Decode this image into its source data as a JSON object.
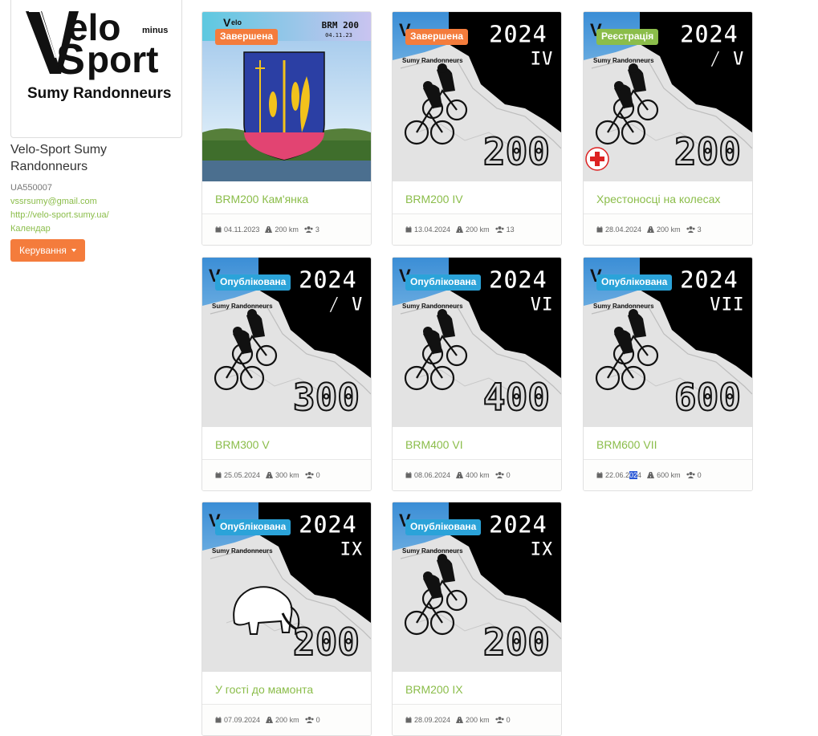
{
  "sidebar": {
    "logo": {
      "line1": "elo",
      "line2": "port",
      "minus": "minus",
      "subtitle": "Sumy Randonneurs"
    },
    "club_name": "Velo-Sport Sumy Randonneurs",
    "club_code": "UA550007",
    "email": "vssrsumy@gmail.com",
    "website": "http://velo-sport.sumy.ua/",
    "calendar": "Календар",
    "manage_button": "Керування"
  },
  "colors": {
    "accent_green": "#8bbd4a",
    "accent_orange": "#f47c3c",
    "accent_blue": "#2ba3d9"
  },
  "cards": [
    {
      "badge": "Завершена",
      "badge_color": "orange",
      "title": "BRM200 Кам'янка",
      "date": "04.11.2023",
      "distance": "200 km",
      "participants": "3",
      "poster": {
        "style": "river",
        "top_label": "BRM 200",
        "top_date": "04.11.23",
        "brand": "elo"
      }
    },
    {
      "badge": "Завершена",
      "badge_color": "orange",
      "title": "BRM200 IV",
      "date": "13.04.2024",
      "distance": "200 km",
      "participants": "13",
      "poster": {
        "style": "map",
        "year": "2024",
        "roman": "IV",
        "number": "200",
        "subtitle": "Sumy Randonneurs",
        "figure": "cyclists",
        "red_cross": false
      }
    },
    {
      "badge": "Реєстрація",
      "badge_color": "green",
      "title": "Хрестоносці на колесах",
      "date": "28.04.2024",
      "distance": "200 km",
      "participants": "3",
      "poster": {
        "style": "map",
        "year": "2024",
        "roman": "/ V",
        "number": "200",
        "subtitle": "Sumy Randonneurs",
        "figure": "cyclists",
        "red_cross": true
      }
    },
    {
      "badge": "Опублікована",
      "badge_color": "blue",
      "title": "BRM300 V",
      "date": "25.05.2024",
      "distance": "300 km",
      "participants": "0",
      "poster": {
        "style": "map",
        "year": "2024",
        "roman": "/ V",
        "number": "300",
        "subtitle": "Sumy Randonneurs",
        "figure": "cyclists",
        "red_cross": false
      }
    },
    {
      "badge": "Опублікована",
      "badge_color": "blue",
      "title": "BRM400 VI",
      "date": "08.06.2024",
      "distance": "400 km",
      "participants": "0",
      "poster": {
        "style": "map",
        "year": "2024",
        "roman": "VI",
        "number": "400",
        "subtitle": "Sumy Randonneurs",
        "figure": "cyclists",
        "red_cross": false
      }
    },
    {
      "badge": "Опублікована",
      "badge_color": "blue",
      "title": "BRM600 VII",
      "date_parts": [
        "22.06.2",
        "02",
        "4"
      ],
      "date": "22.06.2024",
      "distance": "600 km",
      "participants": "0",
      "poster": {
        "style": "map",
        "year": "2024",
        "roman": "VII",
        "number": "600",
        "subtitle": "Sumy Randonneurs",
        "figure": "cyclists",
        "red_cross": false
      }
    },
    {
      "badge": "Опублікована",
      "badge_color": "blue",
      "title": "У гості до мамонта",
      "date": "07.09.2024",
      "distance": "200 km",
      "participants": "0",
      "poster": {
        "style": "map",
        "year": "2024",
        "roman": "IX",
        "number": "200",
        "subtitle": "Sumy Randonneurs",
        "figure": "mammoth",
        "red_cross": false
      }
    },
    {
      "badge": "Опублікована",
      "badge_color": "blue",
      "title": "BRM200 IX",
      "date": "28.09.2024",
      "distance": "200 km",
      "participants": "0",
      "poster": {
        "style": "map",
        "year": "2024",
        "roman": "IX",
        "number": "200",
        "subtitle": "Sumy Randonneurs",
        "figure": "cyclists",
        "red_cross": false
      }
    }
  ]
}
